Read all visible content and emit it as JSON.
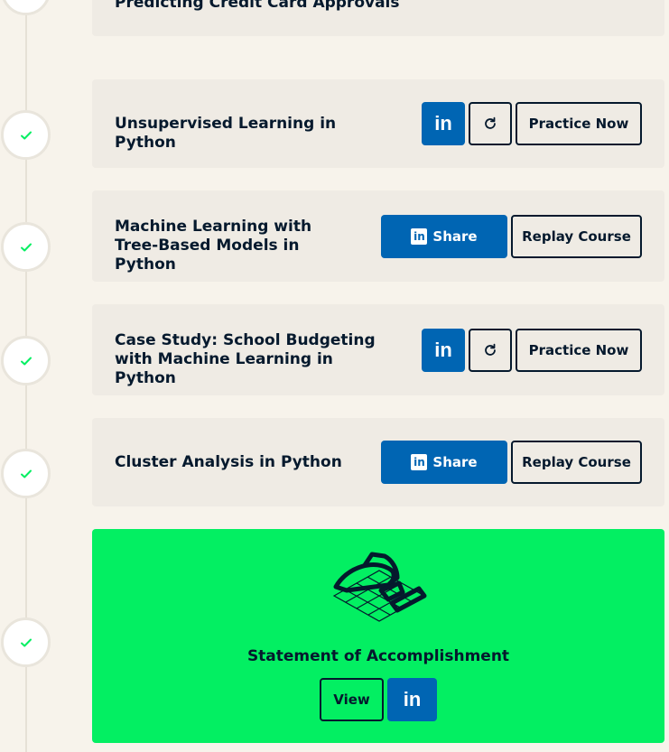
{
  "colors": {
    "background": "#f7f3eb",
    "card": "#efebe4",
    "dark_navy": "#05192d",
    "linkedin_blue": "#0065b3",
    "accent_green": "#03ef62",
    "check_green": "#03ef62"
  },
  "courses": [
    {
      "title": "Predicting Credit Card Approvals"
    },
    {
      "title": "Unsupervised Learning in Python",
      "linkedin_icon": "linkedin-icon",
      "restart_icon": "refresh-icon",
      "primary_label": "Practice Now"
    },
    {
      "title": "Machine Learning with Tree-Based Models in Python",
      "share_label": "Share",
      "secondary_label": "Replay Course"
    },
    {
      "title": "Case Study: School Budgeting with Machine Learning in Python",
      "linkedin_icon": "linkedin-icon",
      "restart_icon": "refresh-icon",
      "primary_label": "Practice Now"
    },
    {
      "title": "Cluster Analysis in Python",
      "share_label": "Share",
      "secondary_label": "Replay Course"
    }
  ],
  "accomplishment": {
    "icon": "trophy-icon",
    "title": "Statement of Accomplishment",
    "view_label": "View",
    "linkedin_icon": "linkedin-icon"
  },
  "timeline_icon": "check-icon"
}
